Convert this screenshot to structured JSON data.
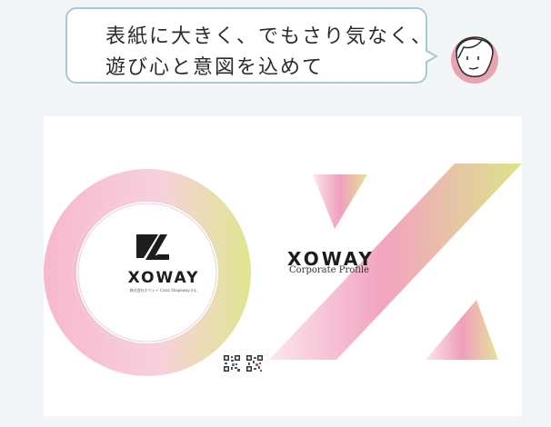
{
  "bubble": {
    "line1": "表紙に大きく、でもさり気なく、",
    "line2": "遊び心と意図を込めて",
    "border_color": "#a9c8d6"
  },
  "avatar": {
    "icon": "person-avatar-icon",
    "face_color": "#e8a3b3"
  },
  "cover": {
    "logo_text": "XOWAY",
    "logo_subtitle": "株式会社ホウェイ Cross Shapeway Inc.",
    "brand_title": "XOWAY",
    "brand_subtitle": "Corporate Profile",
    "qr_codes": [
      "qr-code-icon",
      "qr-code-icon"
    ],
    "gradient_colors": [
      "#f2a3c0",
      "#f7c8d6",
      "#dde88a"
    ]
  }
}
